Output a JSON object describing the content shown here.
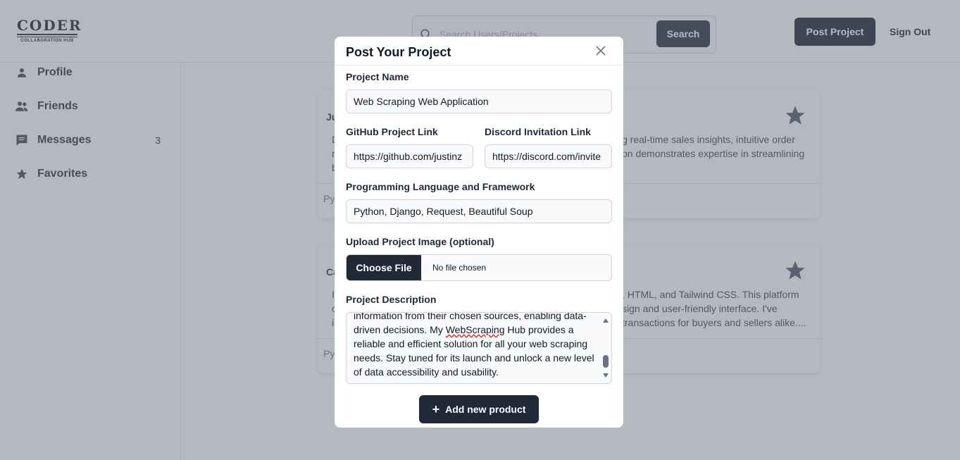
{
  "header": {
    "logo_text": "CODER",
    "logo_subtext": "COLLABORATION HUB",
    "search_placeholder": "Search Users/Projects",
    "search_button": "Search",
    "post_project_button": "Post Project",
    "sign_out": "Sign Out"
  },
  "sidebar": {
    "items": [
      {
        "label": "Profile",
        "icon": "user-icon"
      },
      {
        "label": "Friends",
        "icon": "friends-icon"
      },
      {
        "label": "Messages",
        "icon": "message-icon",
        "badge": "3"
      },
      {
        "label": "Favorites",
        "icon": "star-icon"
      }
    ]
  },
  "cards": [
    {
      "title": "Ju",
      "desc_left": [
        "D",
        "r",
        "b"
      ],
      "desc_right": [
        "g real-time sales insights, intuitive order",
        "on demonstrates expertise in streamlining"
      ],
      "tag": "Py"
    },
    {
      "title": "Ca",
      "desc_left": [
        "I",
        "c",
        "i"
      ],
      "desc_right": [
        ", HTML, and Tailwind CSS. This platform",
        "sign and user-friendly interface. I've",
        "transactions for buyers and sellers alike...."
      ],
      "tag": "Py"
    }
  ],
  "modal": {
    "title": "Post Your Project",
    "project_name_label": "Project Name",
    "project_name_value": "Web Scraping Web Application",
    "github_label": "GitHub Project Link",
    "github_value": "https://github.com/justinz",
    "discord_label": "Discord Invitation Link",
    "discord_value": "https://discord.com/invite",
    "language_label": "Programming Language and Framework",
    "language_value": "Python, Django, Request, Beautiful Soup",
    "upload_label": "Upload Project Image (optional)",
    "choose_file": "Choose File",
    "no_file": "No file chosen",
    "description_label": "Project Description",
    "description_lines": {
      "l1": "information from their chosen sources, enabling data-",
      "l2a": "driven decisions. My ",
      "l2b": "WebScraping",
      "l2c": " Hub provides a",
      "l3": "reliable and efficient solution for all your web scraping",
      "l4": "needs. Stay tuned for its launch and unlock a new level",
      "l5": "of data accessibility and usability."
    },
    "add_button": "Add new product"
  },
  "colors": {
    "primary_dark": "#1f2937",
    "overlay": "rgba(107,114,128,0.5)",
    "spellcheck": "#dc2626"
  }
}
